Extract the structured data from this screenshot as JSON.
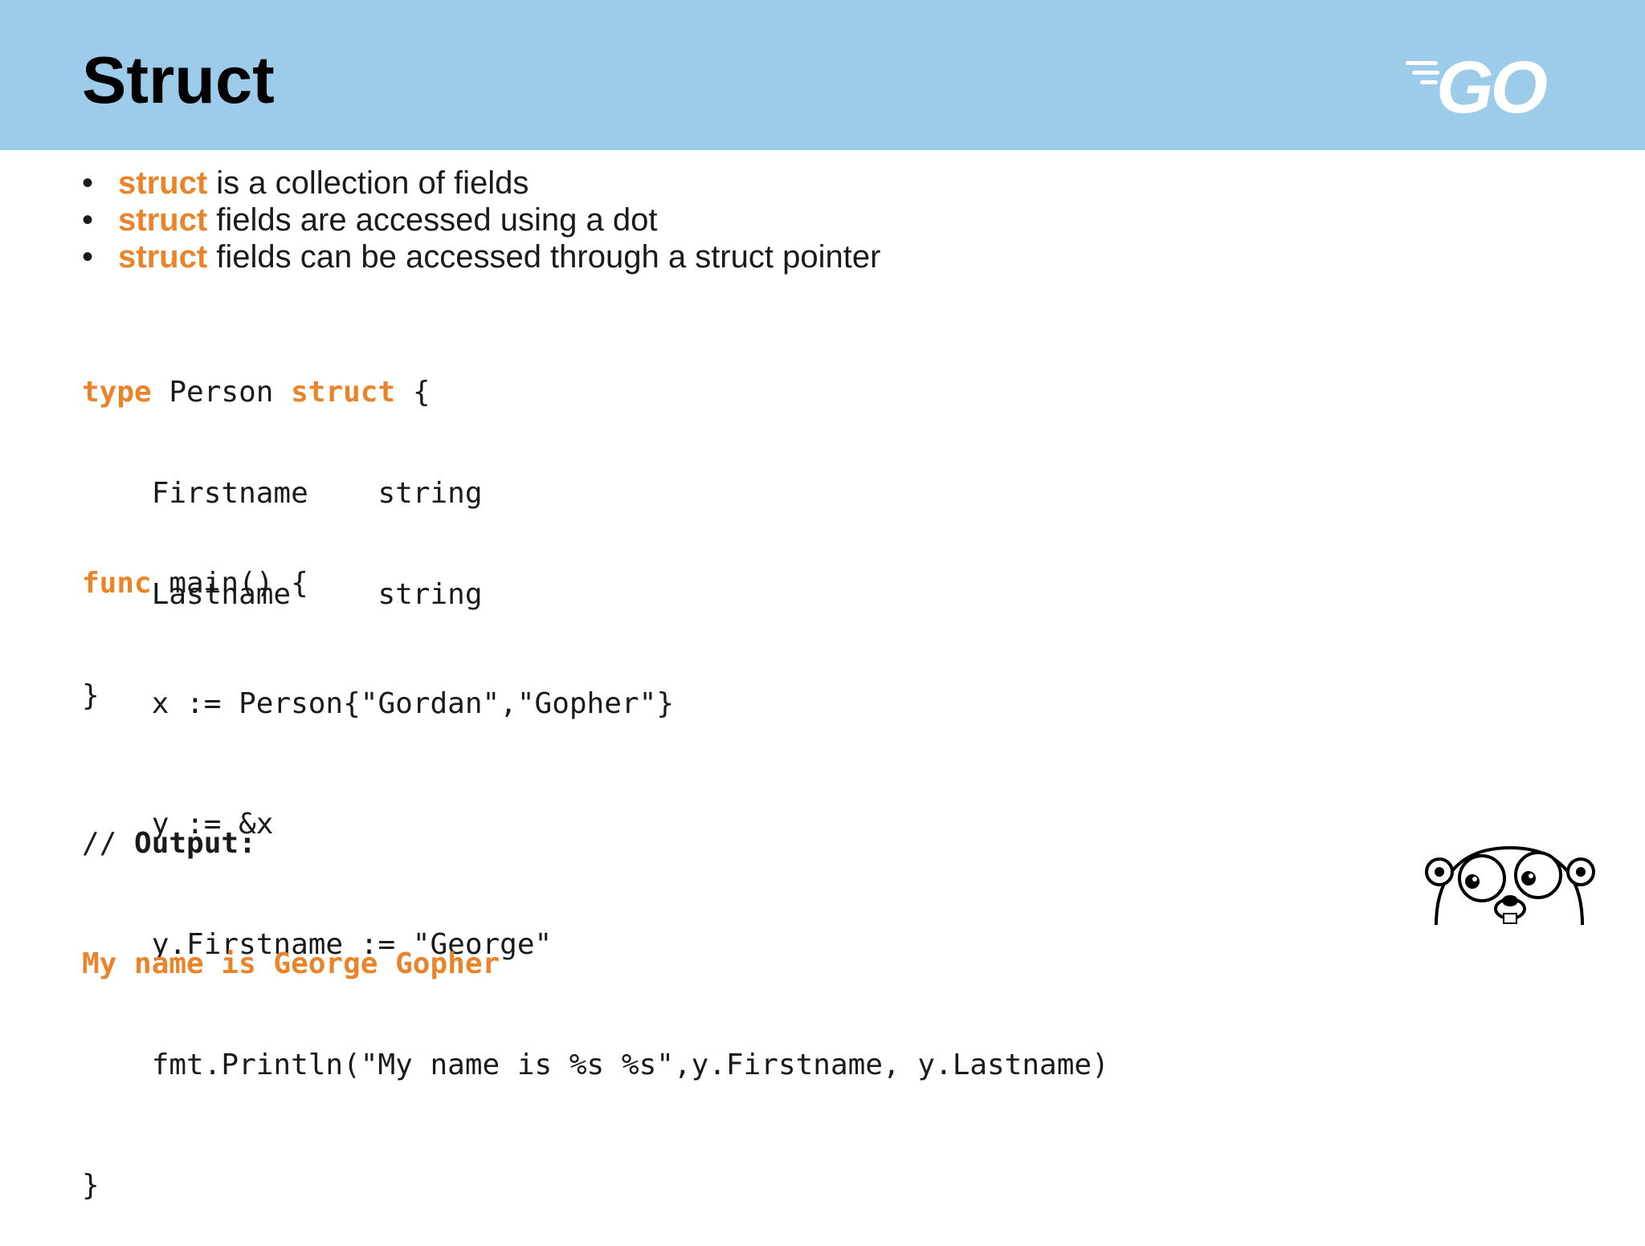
{
  "slide": {
    "title": "Struct",
    "logo_text": "GO"
  },
  "bullets": [
    {
      "keyword": "struct",
      "text": " is a collection of fields"
    },
    {
      "keyword": "struct",
      "text": " fields are accessed using a dot"
    },
    {
      "keyword": "struct",
      "text": " fields can be accessed through a struct pointer"
    }
  ],
  "code_type": {
    "kw_type": "type",
    "name": " Person ",
    "kw_struct": "struct",
    "open": " {",
    "field1": "    Firstname    string",
    "field2": "    Lastname     string",
    "close": "}"
  },
  "code_main": {
    "kw_func": "func",
    "sig": " main() {",
    "line1": "    x := Person{\"Gordan\",\"Gopher\"}",
    "line2": "    y := &x",
    "line3": "    y.Firstname := \"George\"",
    "line4": "    fmt.Println(\"My name is %s %s\",y.Firstname, y.Lastname)",
    "close": "}"
  },
  "output": {
    "comment_prefix": "// ",
    "comment_label": "Output:",
    "result": "My name is George Gopher"
  },
  "colors": {
    "header_bg": "#9dcbea",
    "keyword": "#e9842a"
  },
  "icons": [
    "go-logo-icon",
    "gopher-mascot-icon"
  ]
}
